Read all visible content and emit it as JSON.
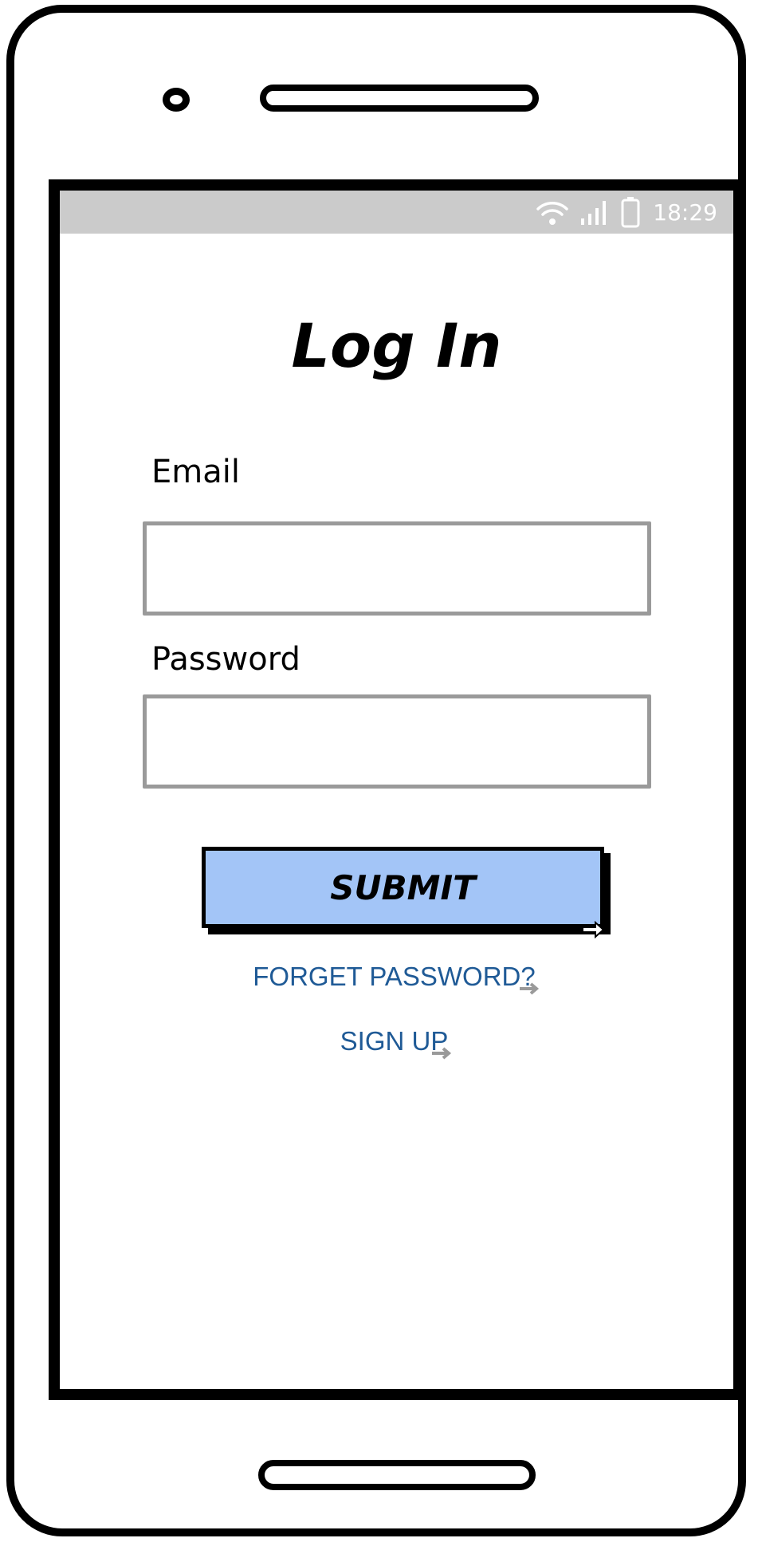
{
  "status_bar": {
    "time": "18:29",
    "icons": [
      "wifi-icon",
      "signal-icon",
      "battery-icon"
    ]
  },
  "login": {
    "title": "Log In",
    "email_label": "Email",
    "email_value": "",
    "password_label": "Password",
    "password_value": "",
    "submit_label": "SUBMIT",
    "forgot_link": "FORGET PASSWORD?",
    "signup_link": "SIGN UP"
  },
  "colors": {
    "submit_bg": "#a3c5f7",
    "link": "#1f5a96",
    "status_bar_bg": "#cbcbcb",
    "input_border": "#9a9a9a"
  }
}
